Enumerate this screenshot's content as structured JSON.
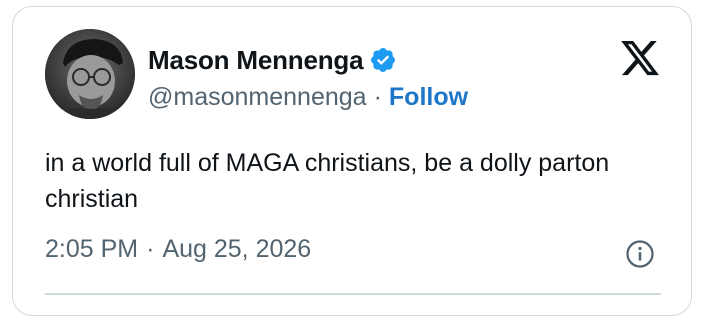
{
  "author": {
    "display_name": "Mason Mennenga",
    "handle": "@masonmennenga",
    "separator": "·",
    "follow_label": "Follow",
    "verified": true
  },
  "tweet": {
    "text": "in a world full of MAGA christians, be a dolly parton christian"
  },
  "meta": {
    "time": "2:05 PM",
    "separator": "·",
    "date": "Aug 25, 2026"
  },
  "icons": {
    "verified": "verified-badge-icon",
    "brand": "x-logo-icon",
    "info": "info-icon"
  },
  "colors": {
    "text": "#0f1419",
    "secondary": "#536471",
    "link": "#1d76c8",
    "verified": "#1d9bf0",
    "border": "#cfd9de"
  }
}
